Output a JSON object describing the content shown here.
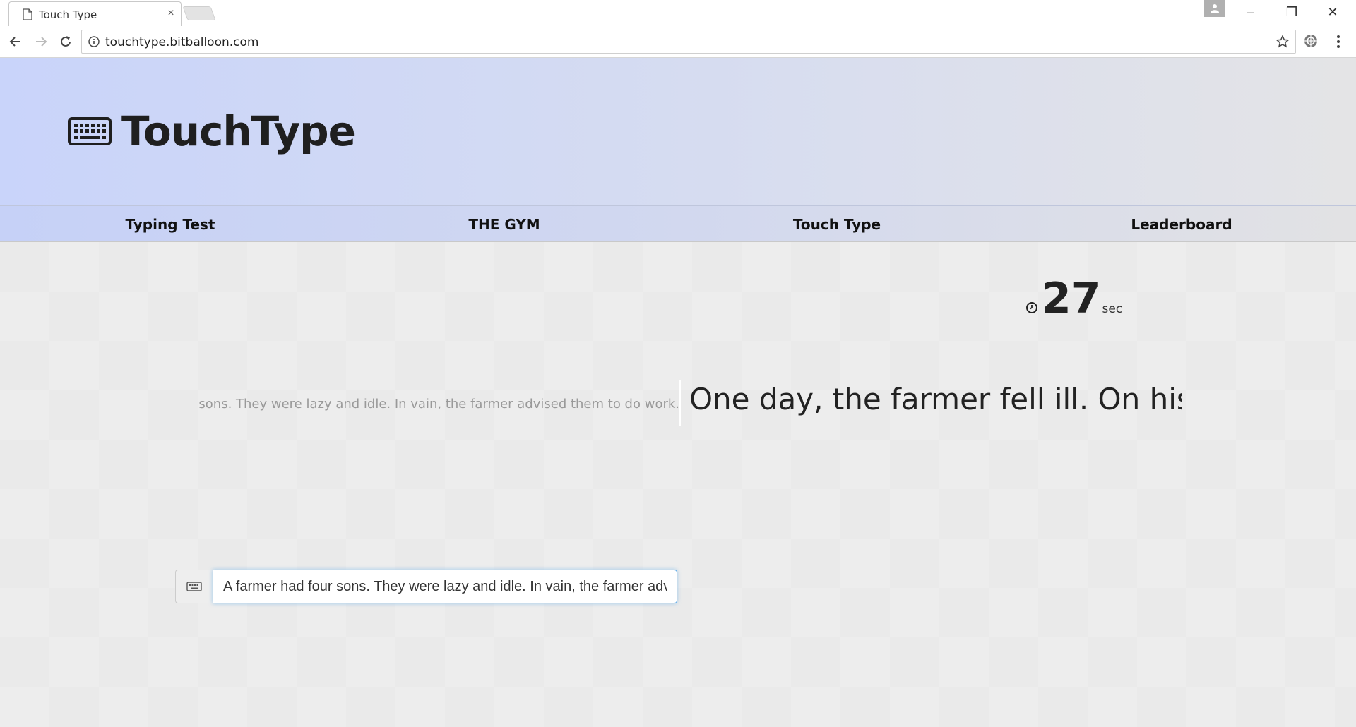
{
  "browser": {
    "tab_title": "Touch Type",
    "tab_close": "×",
    "url": "touchtype.bitballoon.com",
    "window_controls": {
      "minimize": "–",
      "restore": "❐",
      "close": "✕"
    }
  },
  "header": {
    "logo_text": "TouchType",
    "logo_icon": "keyboard-icon"
  },
  "nav": {
    "items": [
      {
        "label": "Typing Test"
      },
      {
        "label": "THE GYM"
      },
      {
        "label": "Touch Type"
      },
      {
        "label": "Leaderboard"
      }
    ]
  },
  "timer": {
    "value": "27",
    "unit": "sec",
    "icon": "clock-icon"
  },
  "passage": {
    "typed": "sons. They were lazy and idle. In vain, the farmer advised them to do work.",
    "upcoming": "One day, the farmer fell ill. On his de"
  },
  "input": {
    "value": "A farmer had four sons. They were lazy and idle. In vain, the farmer advised them to do work.",
    "icon": "keyboard-icon"
  },
  "colors": {
    "hero_start": "#c9d4fa",
    "hero_end": "#e4e4e6",
    "focus_border": "#66afe9"
  }
}
